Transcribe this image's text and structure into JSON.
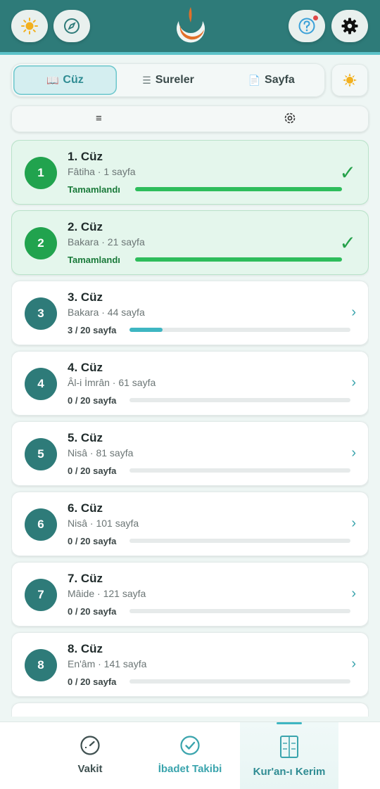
{
  "header": {
    "buttons": [
      "sun-icon",
      "compass-icon",
      "help-icon",
      "gear-icon"
    ],
    "colors": {
      "bar": "#2e7b79",
      "accent": "#5cc2c8"
    }
  },
  "tabs": [
    {
      "label": "Cüz",
      "icon": "book-icon",
      "active": true
    },
    {
      "label": "Sureler",
      "icon": "list-icon",
      "active": false
    },
    {
      "label": "Sayfa",
      "icon": "page-icon",
      "active": false
    }
  ],
  "juz_list": [
    {
      "number": "1",
      "title": "1. Cüz",
      "subtitle": "Fâtiha · 1 sayfa",
      "status": "Tamamlandı",
      "progress": 1.0,
      "completed": true
    },
    {
      "number": "2",
      "title": "2. Cüz",
      "subtitle": "Bakara · 21 sayfa",
      "status": "Tamamlandı",
      "progress": 1.0,
      "completed": true
    },
    {
      "number": "3",
      "title": "3. Cüz",
      "subtitle": "Bakara · 44 sayfa",
      "status": "3 / 20 sayfa",
      "progress": 0.15,
      "completed": false
    },
    {
      "number": "4",
      "title": "4. Cüz",
      "subtitle": "Âl-i İmrân · 61 sayfa",
      "status": "0 / 20 sayfa",
      "progress": 0,
      "completed": false
    },
    {
      "number": "5",
      "title": "5. Cüz",
      "subtitle": "Nisâ · 81 sayfa",
      "status": "0 / 20 sayfa",
      "progress": 0,
      "completed": false
    },
    {
      "number": "6",
      "title": "6. Cüz",
      "subtitle": "Nisâ · 101 sayfa",
      "status": "0 / 20 sayfa",
      "progress": 0,
      "completed": false
    },
    {
      "number": "7",
      "title": "7. Cüz",
      "subtitle": "Mâide · 121 sayfa",
      "status": "0 / 20 sayfa",
      "progress": 0,
      "completed": false
    },
    {
      "number": "8",
      "title": "8. Cüz",
      "subtitle": "En'âm · 141 sayfa",
      "status": "0 / 20 sayfa",
      "progress": 0,
      "completed": false
    }
  ],
  "bottom_nav": [
    {
      "label": "Vakit",
      "icon": "clock-icon"
    },
    {
      "label": "İbadet Takibi",
      "icon": "check-circle-icon"
    },
    {
      "label": "Kur'an-ı Kerim",
      "icon": "quran-book-icon",
      "active": true
    }
  ]
}
